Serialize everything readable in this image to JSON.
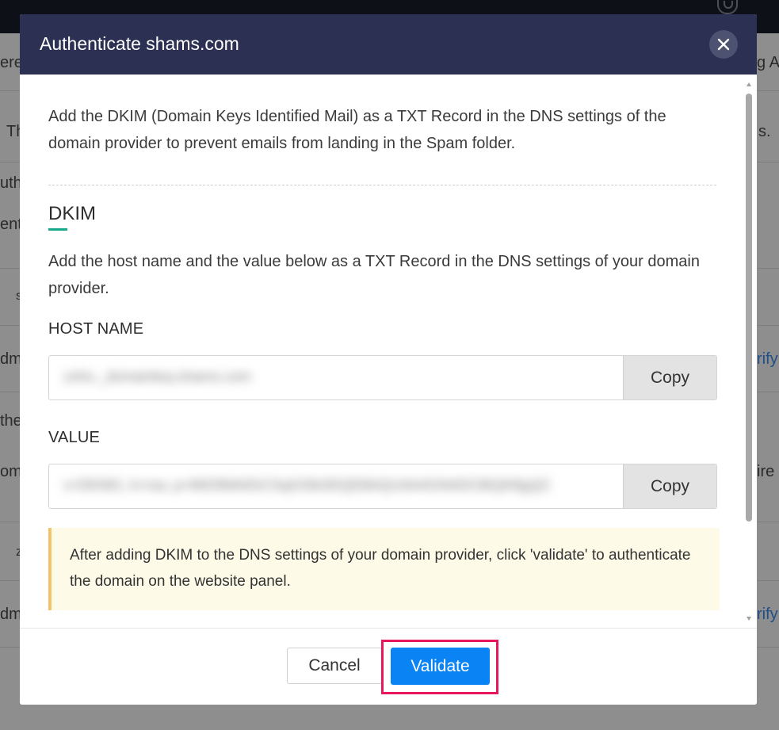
{
  "background": {
    "row1_left": "ere",
    "row1_right": "g A",
    "row2_left": "Th",
    "row2_right": "s.",
    "row3_left": "uth",
    "row4_left": "ent",
    "row5_left": "s",
    "row6_left": "dm",
    "row6_right": "rify",
    "row7_left": "the",
    "row8_left": "oma",
    "row8_right": "ire",
    "row9_left": "z",
    "row10_left": "dm",
    "row10_right": "rify"
  },
  "modal": {
    "title": "Authenticate shams.com",
    "intro": "Add the DKIM (Domain Keys Identified Mail) as a TXT Record in the DNS settings of the domain provider to prevent emails from landing in the Spam folder.",
    "section_title": "DKIM",
    "section_desc": "Add the host name and the value below as a TXT Record in the DNS settings of your domain provider.",
    "host_label": "HOST NAME",
    "host_value": "zoho._domainkey.shams.com",
    "host_copy": "Copy",
    "value_label": "VALUE",
    "value_value": "v=DKIM1; k=rsa; p=MIGfMA0GCSqGSIb3DQEBAQUAA4GNADCBiQKBgQC",
    "value_copy": "Copy",
    "notice": "After adding DKIM to the DNS settings of your domain provider, click 'validate' to authenticate the domain on the website panel.",
    "cancel_label": "Cancel",
    "validate_label": "Validate"
  },
  "colors": {
    "header_bg": "#2c3153",
    "accent_green": "#19a88a",
    "primary_blue": "#0a83f5",
    "highlight_pink": "#e8175d",
    "notice_bg": "#fdfbe7",
    "notice_border": "#f2c36b"
  }
}
